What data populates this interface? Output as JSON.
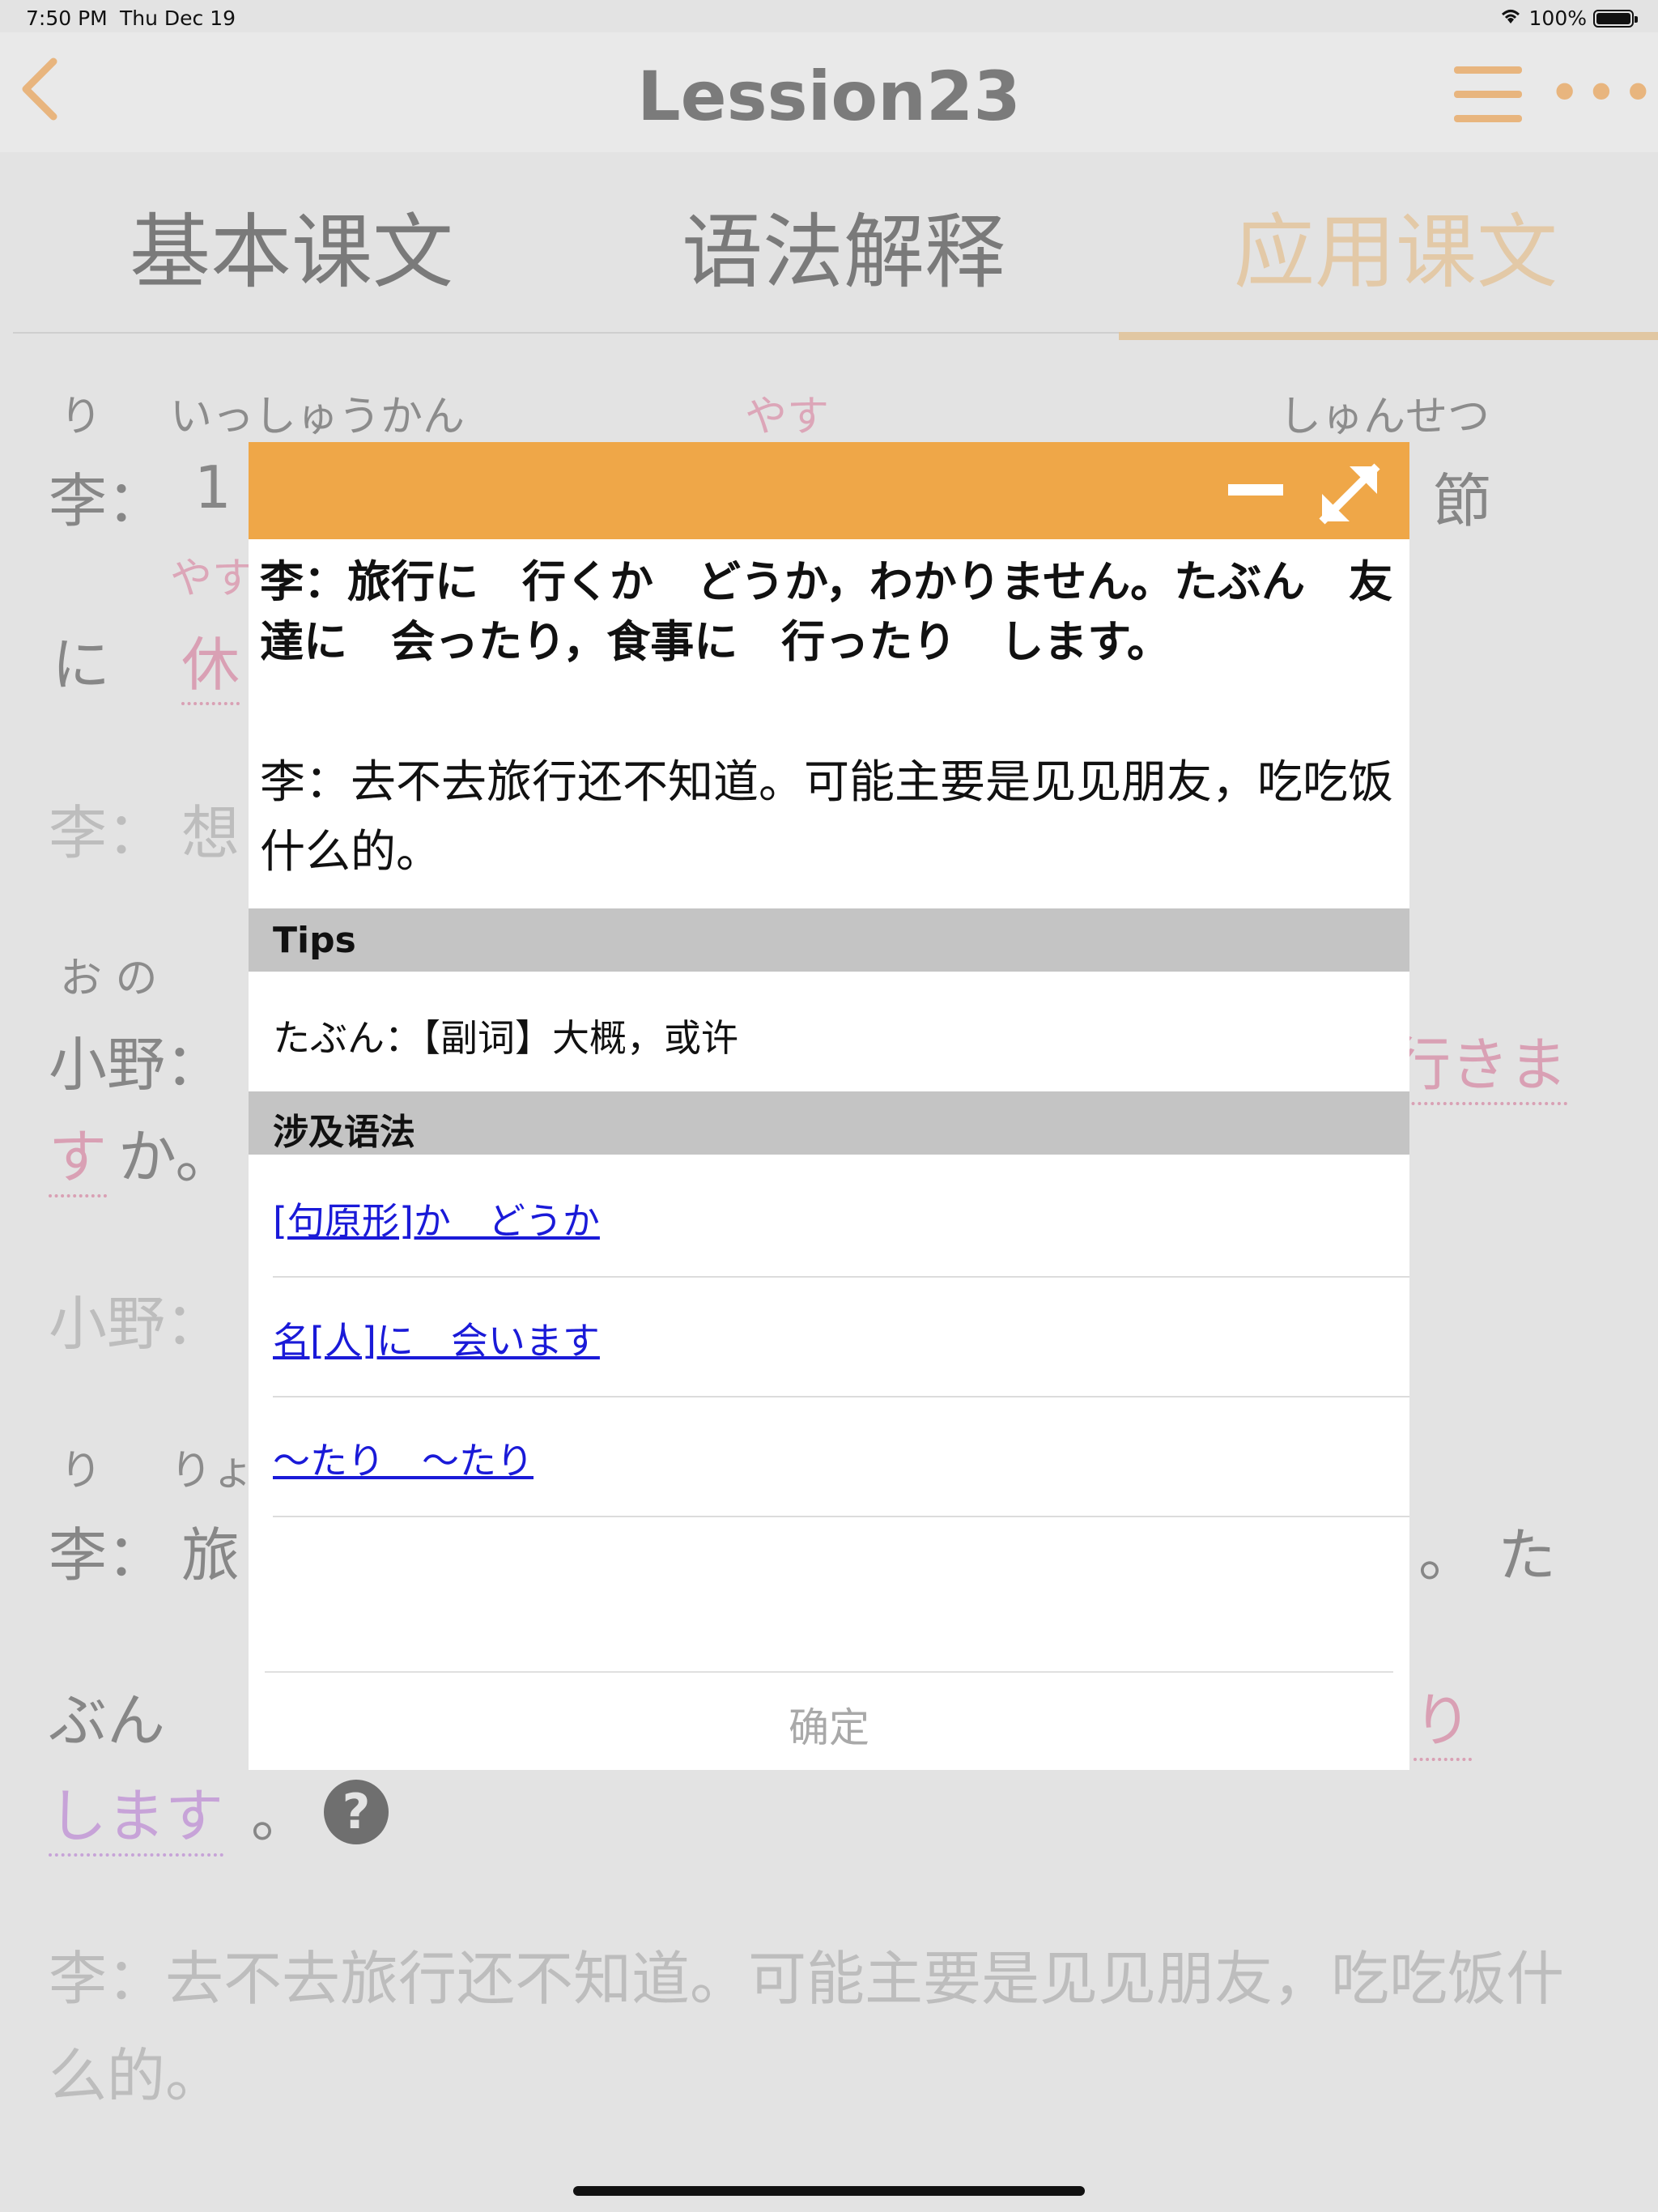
{
  "status": {
    "time": "7:50 PM",
    "date": "Thu Dec 19",
    "battery": "100%"
  },
  "nav": {
    "title": "Lession23"
  },
  "tabs": [
    {
      "label": "基本课文"
    },
    {
      "label": "语法解释"
    },
    {
      "label": "应用课文"
    }
  ],
  "background": {
    "line1_ruby": [
      "り",
      "いっしゅうかん",
      "やす",
      "しゅんせつ"
    ],
    "line1_text": [
      "李：",
      "1",
      "節"
    ],
    "line2_ruby": "やす",
    "line2_text": [
      "に",
      "休"
    ],
    "line3_text": [
      "李：",
      "想"
    ],
    "line4_ruby": "お の",
    "line4_text": [
      "小野：",
      "行きま"
    ],
    "line5_text": [
      "す",
      "か。"
    ],
    "line6_text": "小野：",
    "line7_ruby": [
      "り",
      "りょ"
    ],
    "line7_text": [
      "李：",
      "旅",
      "。",
      "た"
    ],
    "line8_text": [
      "ぶん",
      "り"
    ],
    "line9_text": [
      "します",
      "。"
    ],
    "help_icon_label": "?",
    "translation": "李：去不去旅行还不知道。可能主要是见见朋友，吃吃饭什么的。"
  },
  "modal": {
    "jp_sentence": "李：旅行に　行くか　どうか，わかりません。たぶん　友達に　会ったり，食事に　行ったり　します。",
    "cn_sentence": "李：去不去旅行还不知道。可能主要是见见朋友，吃吃饭什么的。",
    "tips_label": "Tips",
    "tip_text": "たぶん：【副词】大概，或许",
    "grammar_label": "涉及语法",
    "grammar_links": [
      "[句原形]か　どうか",
      "名[人]に　会います",
      "～たり　～たり"
    ],
    "confirm_label": "确定"
  }
}
